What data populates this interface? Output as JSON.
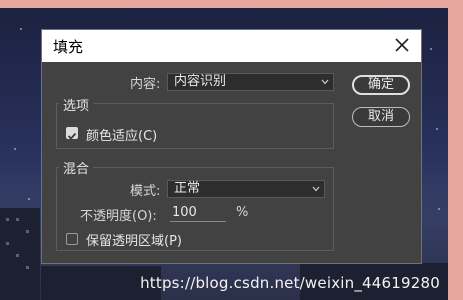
{
  "dialog": {
    "title": "填充",
    "content_label": "内容:",
    "content_value": "内容识别",
    "ok_label": "确定",
    "cancel_label": "取消"
  },
  "options": {
    "legend": "选项",
    "color_adapt_label": "颜色适应(C)",
    "color_adapt_checked": true
  },
  "blending": {
    "legend": "混合",
    "mode_label": "模式:",
    "mode_value": "正常",
    "opacity_label": "不透明度(O):",
    "opacity_value": "100",
    "opacity_unit": "%",
    "preserve_label": "保留透明区域(P)",
    "preserve_checked": false
  },
  "watermark": "https://blog.csdn.net/weixin_44619280"
}
